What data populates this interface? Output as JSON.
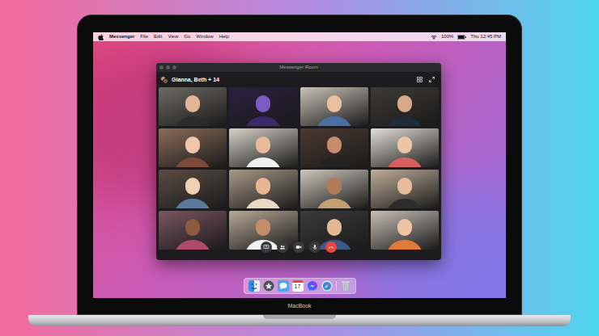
{
  "menu_bar": {
    "app": "Messenger",
    "items": [
      "File",
      "Edit",
      "View",
      "Go",
      "Window",
      "Help"
    ],
    "battery": "100%",
    "clock": "Thu 12:45 PM"
  },
  "window": {
    "title": "Messenger Room",
    "participants_label": "Gianna, Beth + 14"
  },
  "video_tiles": [
    {
      "camera_on": true
    },
    {
      "camera_on": true
    },
    {
      "camera_on": true
    },
    {
      "camera_on": true
    },
    {
      "camera_on": true
    },
    {
      "camera_on": true
    },
    {
      "camera_on": true
    },
    {
      "camera_on": true
    },
    {
      "camera_on": true
    },
    {
      "camera_on": true
    },
    {
      "camera_on": true
    },
    {
      "camera_on": true
    },
    {
      "camera_on": true
    },
    {
      "camera_on": true
    },
    {
      "camera_on": true
    },
    {
      "camera_on": true
    }
  ],
  "controls": [
    {
      "kind": "screen-share"
    },
    {
      "kind": "participants"
    },
    {
      "kind": "camera"
    },
    {
      "kind": "microphone"
    },
    {
      "kind": "end-call"
    }
  ],
  "dock": [
    {
      "kind": "finder"
    },
    {
      "kind": "launchpad"
    },
    {
      "kind": "messages"
    },
    {
      "kind": "calendar",
      "label": "17"
    },
    {
      "kind": "messenger"
    },
    {
      "kind": "safari"
    },
    {
      "kind": "trash"
    }
  ],
  "laptop": {
    "label": "MacBook"
  }
}
